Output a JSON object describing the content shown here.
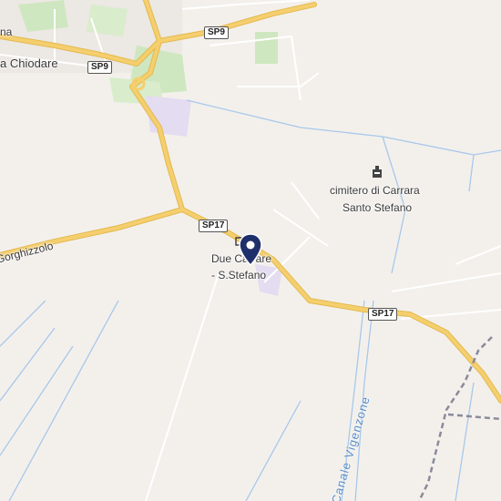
{
  "places": {
    "chiodare": "a Chiodare",
    "gorghizzolo": "Gorghizzolo",
    "cem_line1": "cimitero di Carrara",
    "cem_line2": "Santo Stefano",
    "town_line1": "Due Carrare",
    "town_line2": "- S.Stefano",
    "top_left_fragment": "na"
  },
  "roads": {
    "sp9_a": "SP9",
    "sp9_b": "SP9",
    "sp17_a": "SP17",
    "sp17_b": "SP17"
  },
  "water": {
    "canal": "Canale Vigenzone"
  },
  "icons": {
    "pin": "location-pin-icon",
    "cemetery": "cemetery-icon"
  },
  "colors": {
    "background": "#f3f0ec",
    "major_road": "#f5cf6e",
    "water": "#a8c8ea",
    "park": "#cfe7c0",
    "pin": "#1f2f6b",
    "boundary": "#8a8a9a"
  }
}
